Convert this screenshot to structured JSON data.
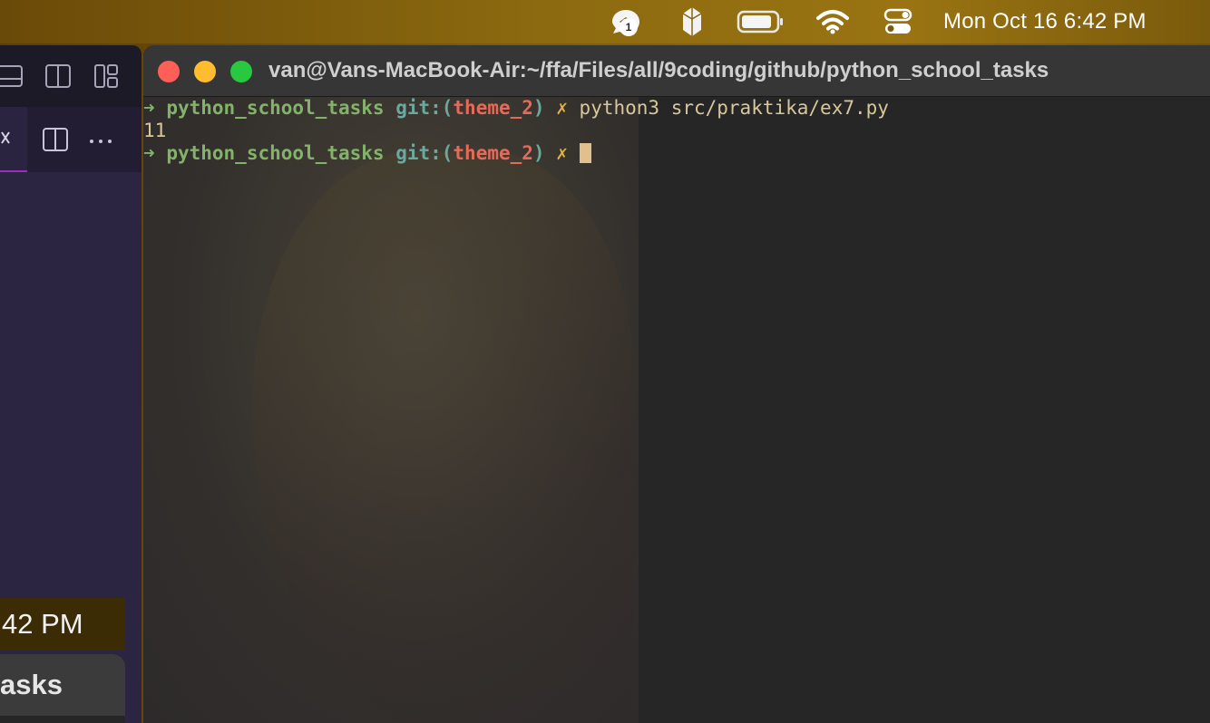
{
  "menubar": {
    "notification_count": "1",
    "clock": "Mon Oct 16  6:42 PM",
    "icons": [
      "notifications-icon",
      "crystal-app-icon",
      "battery-icon",
      "wifi-icon",
      "control-center-icon"
    ]
  },
  "left_window": {
    "icons": [
      "panel-bottom-icon",
      "split-editor-icon",
      "layout-icon",
      "close-tab-icon",
      "split-right-icon",
      "more-icon"
    ]
  },
  "background_fragments": {
    "clock_fragment": "42 PM",
    "title_fragment": "asks"
  },
  "terminal": {
    "title": "van@Vans-MacBook-Air:~/ffa/Files/all/9coding/github/python_school_tasks",
    "lines": [
      {
        "arrow": "➜",
        "dir": "python_school_tasks",
        "git_open": "git:(",
        "branch": "theme_2",
        "git_close": ")",
        "dirty": "✗",
        "command": "python3 src/praktika/ex7.py"
      },
      {
        "output": "11"
      },
      {
        "arrow": "➜",
        "dir": "python_school_tasks",
        "git_open": "git:(",
        "branch": "theme_2",
        "git_close": ")",
        "dirty": "✗",
        "command": ""
      }
    ]
  },
  "colors": {
    "prompt_green": "#83b26a",
    "git_teal": "#6aa8a0",
    "branch_red": "#e56a5a",
    "dirty_yellow": "#e0b04a",
    "cursor": "#e2c08d"
  }
}
